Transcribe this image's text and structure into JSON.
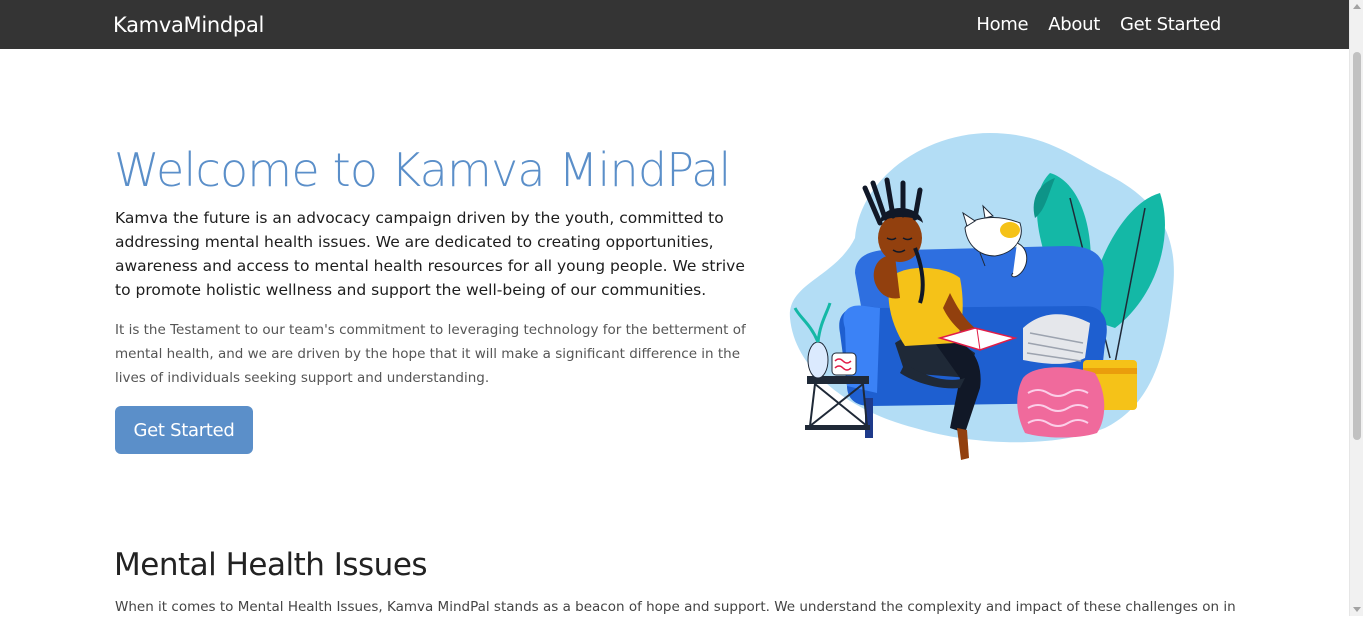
{
  "navbar": {
    "brand": "KamvaMindpal",
    "links": [
      "Home",
      "About",
      "Get Started"
    ]
  },
  "hero": {
    "title": "Welcome to Kamva MindPal",
    "lead": "Kamva the future is an advocacy campaign driven by the youth, committed to addressing mental health issues. We are dedicated to creating opportunities, awareness and access to mental health resources for all young people. We strive to promote holistic wellness and support the well-being of our communities.",
    "body": "It is the Testament to our team's commitment to leveraging technology for the betterment of mental health, and we are driven by the hope that it will make a significant difference in the lives of individuals seeking support and understanding.",
    "cta_label": "Get Started"
  },
  "section": {
    "title": "Mental Health Issues",
    "text": "When it comes to Mental Health Issues, Kamva MindPal stands as a beacon of hope and support. We understand the complexity and impact of these challenges on individuals"
  },
  "illustration": {
    "name": "person-reading-on-sofa-illustration"
  },
  "colors": {
    "navbar_bg": "#343434",
    "accent": "#5b8fc9",
    "blob": "#b3ddf5",
    "sofa": "#2e6fe0",
    "shirt": "#f5c218",
    "plant": "#14b8a6",
    "pillow_pink": "#f06a9c",
    "pot_yellow": "#f5c218"
  }
}
